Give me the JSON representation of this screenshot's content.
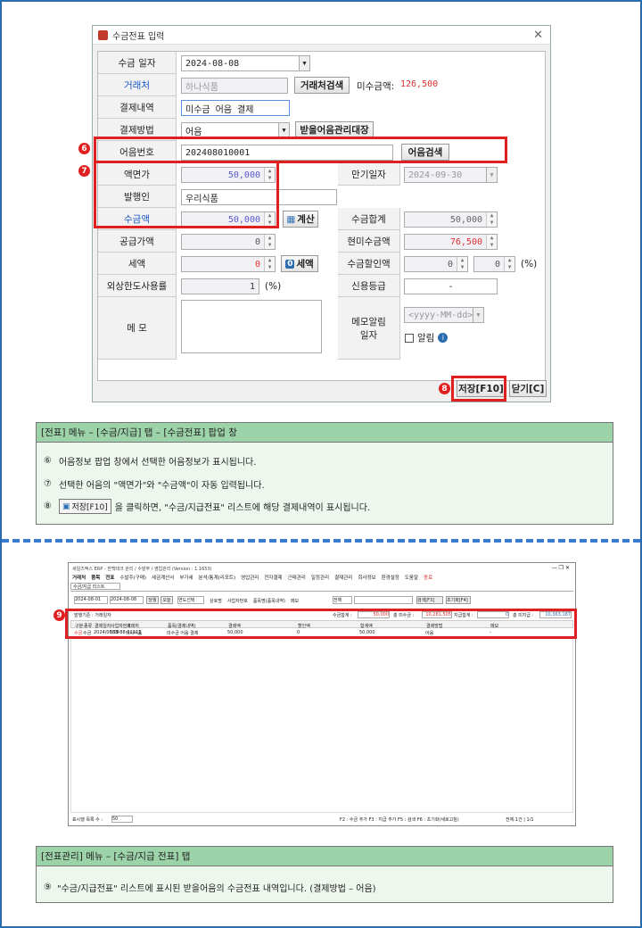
{
  "dialog": {
    "title": "수금전표 입력",
    "close_icon": "close-icon"
  },
  "form": {
    "date_label": "수금 일자",
    "date_value": "2024-08-08",
    "client_label": "거래처",
    "client_value": "하나식품",
    "client_search": "거래처검색",
    "unpaid_label": "미수금액:",
    "unpaid_value": "126,500",
    "detail_label": "결제내역",
    "detail_value": "미수금 어음 결제",
    "method_label": "결제방법",
    "method_value": "어음",
    "bill_ledger": "받을어음관리대장",
    "bill_no_label": "어음번호",
    "bill_no_value": "202408010001",
    "bill_search": "어음검색",
    "face_label": "액면가",
    "face_value": "50,000",
    "due_label": "만기일자",
    "due_value": "2024-09-30",
    "issuer_label": "발행인",
    "issuer_value": "우리식품",
    "amount_label": "수금액",
    "amount_value": "50,000",
    "calc": "계산",
    "total_label": "수금합계",
    "total_value": "50,000",
    "supply_label": "공급가액",
    "supply_value": "0",
    "cash_label": "현미수금액",
    "cash_value": "76,500",
    "tax_label": "세액",
    "tax_value": "0",
    "tax_btn": "세액",
    "discount_label": "수금할인액",
    "discount_value1": "0",
    "discount_value2": "0",
    "percent": "(%)",
    "credit_label": "외상한도사용률",
    "credit_value": "1",
    "credit_unit": "(%)",
    "grade_label": "신용등급",
    "grade_value": "-",
    "memo_label": "메 모",
    "alarm_label": "메모알림\n일자",
    "alarm_placeholder": "<yyyy-MM-dd>",
    "alarm_check": "알림",
    "save": "저장[F10]",
    "close": "닫기[C]"
  },
  "badges": [
    "6",
    "7",
    "8",
    "9"
  ],
  "note1": {
    "header": "[전표] 메뉴 – [수금/지급] 탭 – [수금전표] 팝업 창",
    "lines": [
      "어음정보 팝업 창에서 선택한 어음정보가 표시됩니다.",
      "선택한 어음의 \"액면가\"와 \"수금액\"이 자동 입력됩니다.",
      "을 클릭하면, \"수금/지급전표\" 리스트에 해당 결제내역이 표시됩니다."
    ],
    "nums": [
      "⑥",
      "⑦",
      "⑧"
    ],
    "inline_btn": "저장[F10]"
  },
  "app": {
    "title": "세일즈엑스 ERP - 한백테크 관리 / 수발주 / 영업관리 (Version : 1.1653)",
    "menu": [
      "거래처",
      "품목",
      "전표",
      "수발주(구매)",
      "세금계산서",
      "부가세",
      "분석/통계(리포트)",
      "영업관리",
      "전자결제",
      "근태관리",
      "일정관리",
      "결재관리",
      "회사정보",
      "환경설정",
      "도움말",
      "종료"
    ],
    "tab": "수금/지급 리스트",
    "date_from": "2024-08-01",
    "date_to": "2024-08-08",
    "btn_month": "당월",
    "btn_today": "오늘",
    "year": "연도선택",
    "radios": [
      "상호명",
      "사업자번호",
      "품목명(품목내역)",
      "메모"
    ],
    "filter": "전체",
    "search": "검색[F3]",
    "reset": "초기화[F4]",
    "group_label": "발행기준 : 거래일자",
    "sum_labels": [
      "수금합계 :",
      "총 미수금 :",
      "지급합계 :",
      "총 미지급 :"
    ],
    "sum_values": [
      "50,000",
      "10,281,505",
      "0",
      "10,363,187"
    ],
    "columns": [
      "구분",
      "종류",
      "결제일자",
      "사업자번호",
      "거래처",
      "품목(결제내역)",
      "결제액",
      "할인액",
      "합계액",
      "결제방법",
      "메모"
    ],
    "row": [
      "수금",
      "수금",
      "2024/08/08",
      "555-88-11111",
      "하나식품",
      "미수금 어음 결제",
      "50,000",
      "0",
      "50,000",
      "어음",
      "-"
    ],
    "footer_left": "표시행 목록 수 :",
    "footer_rows": "50",
    "footer_keys": "F2 : 수금 추가 F3 : 지급 추가 F5 : 검색 F6 : 초기화(새로고침)",
    "footer_page": "전체:1건 | 1/1"
  },
  "note2": {
    "header": "[전표관리] 메뉴 – [수금/지급 전표] 탭",
    "num": "⑨",
    "line": "\"수금/지급전표\" 리스트에 표시된 받을어음의 수금전표 내역입니다. (결제방법 – 어음)"
  }
}
